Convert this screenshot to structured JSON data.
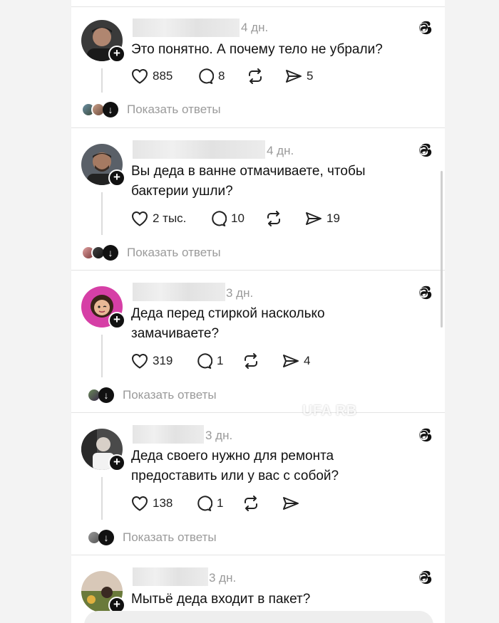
{
  "watermark": "UFA RB",
  "posts": [
    {
      "time": "4 дн.",
      "text": "Это понятно. А почему тело не убрали?",
      "likes": "885",
      "comments": "8",
      "shares": "5",
      "show_replies": "Показать ответы"
    },
    {
      "time": "4 дн.",
      "text": "Вы деда в ванне отмачиваете, чтобы бактерии ушли?",
      "likes": "2 тыс.",
      "comments": "10",
      "shares": "19",
      "show_replies": "Показать ответы"
    },
    {
      "time": "3 дн.",
      "text": "Деда перед стиркой насколько замачиваете?",
      "likes": "319",
      "comments": "1",
      "shares": "4",
      "show_replies": "Показать ответы"
    },
    {
      "time": "3 дн.",
      "text": "Деда своего нужно для ремонта предоставить или у вас с собой?",
      "likes": "138",
      "comments": "1",
      "shares": "",
      "show_replies": "Показать ответы"
    },
    {
      "time": "3 дн.",
      "text": "Мытьё деда входит в пакет?"
    }
  ],
  "icons": {
    "like": "heart-icon",
    "comment": "comment-bubble-icon",
    "repost": "repost-icon",
    "share": "send-icon",
    "platform": "threads-logo-icon",
    "expand": "arrow-down-icon",
    "follow": "plus-icon"
  }
}
